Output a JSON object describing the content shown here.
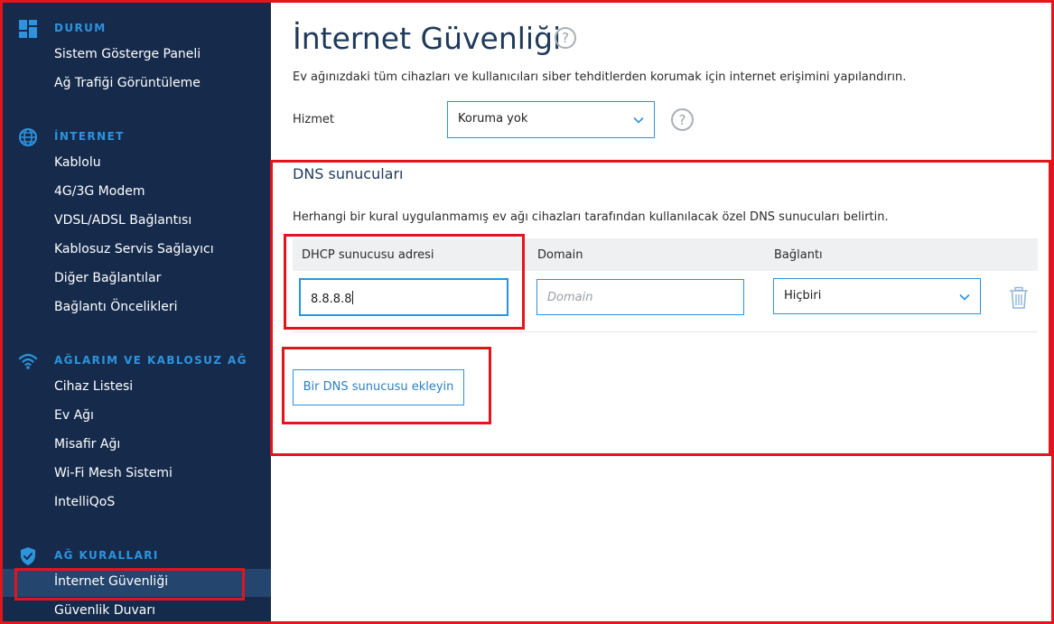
{
  "sidebar": {
    "sections": [
      {
        "title": "DURUM",
        "icon": "dashboard-icon",
        "items": [
          "Sistem Gösterge Paneli",
          "Ağ Trafiği Görüntüleme"
        ]
      },
      {
        "title": "İNTERNET",
        "icon": "globe-icon",
        "items": [
          "Kablolu",
          "4G/3G Modem",
          "VDSL/ADSL Bağlantısı",
          "Kablosuz Servis Sağlayıcı",
          "Diğer Bağlantılar",
          "Bağlantı Öncelikleri"
        ]
      },
      {
        "title": "AĞLARIM VE KABLOSUZ AĞ",
        "icon": "wifi-icon",
        "items": [
          "Cihaz Listesi",
          "Ev Ağı",
          "Misafir Ağı",
          "Wi-Fi Mesh Sistemi",
          "IntelliQoS"
        ]
      },
      {
        "title": "AĞ KURALLARI",
        "icon": "shield-icon",
        "items": [
          "İnternet Güvenliği",
          "Güvenlik Duvarı"
        ]
      }
    ],
    "active_item": "İnternet Güvenliği"
  },
  "page": {
    "title": "İnternet Güvenliği",
    "help_glyph": "?",
    "description": "Ev ağınızdaki tüm cihazları ve kullanıcıları siber tehditlerden korumak için internet erişimini yapılandırın.",
    "service": {
      "label": "Hizmet",
      "selected": "Koruma yok"
    }
  },
  "dns": {
    "title": "DNS sunucuları",
    "description": "Herhangi bir kural uygulanmamış ev ağı cihazları tarafından kullanılacak özel DNS sunucuları belirtin.",
    "columns": [
      "DHCP sunucusu adresi",
      "Domain",
      "Bağlantı"
    ],
    "row": {
      "dhcp_value": "8.8.8.8",
      "domain_placeholder": "Domain",
      "connection_selected": "Hiçbiri"
    },
    "add_button": "Bir DNS sunucusu ekleyin"
  },
  "colors": {
    "sidebar_bg": "#162b4c",
    "accent": "#2d93dd",
    "highlight": "#e3141c",
    "active_bg": "#24456e"
  }
}
